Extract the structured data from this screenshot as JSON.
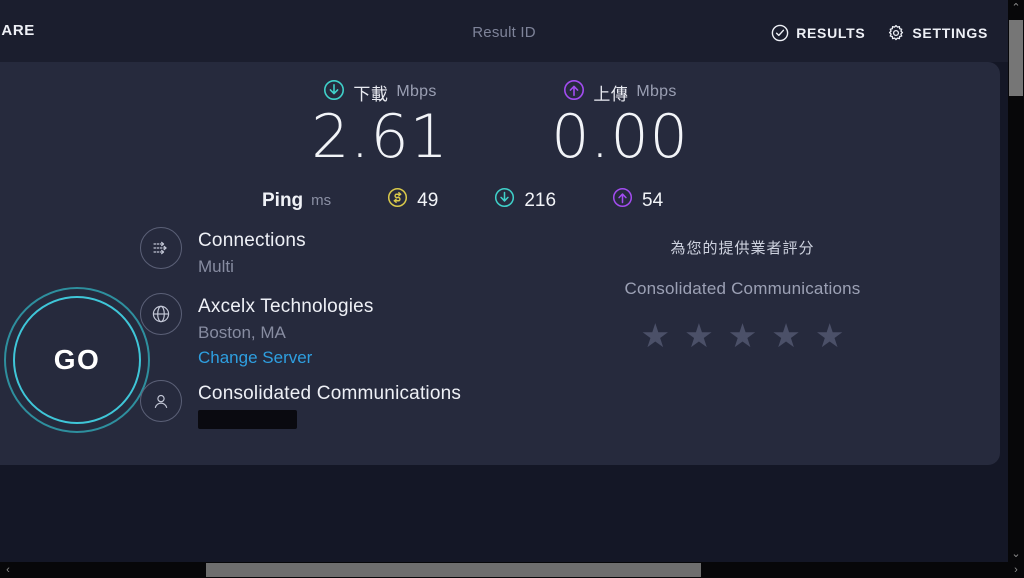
{
  "header": {
    "share_label": "HARE",
    "result_id_label": "Result ID",
    "results_label": "RESULTS",
    "settings_label": "SETTINGS",
    "results_icon": "check-circle-icon",
    "settings_icon": "gear-icon"
  },
  "speeds": {
    "download": {
      "label_cjk": "下載",
      "unit": "Mbps",
      "value": "2.61",
      "icon": "download-arrow-icon",
      "color": "#3fd0c9"
    },
    "upload": {
      "label_cjk": "上傳",
      "unit": "Mbps",
      "value": "0.00",
      "icon": "upload-arrow-icon",
      "color": "#a24cf0"
    }
  },
  "ping": {
    "title": "Ping",
    "unit": "ms",
    "idle": {
      "value": "49",
      "icon": "idle-latency-icon",
      "color": "#d8c84a"
    },
    "download": {
      "value": "216",
      "icon": "download-arrow-icon",
      "color": "#3fd0c9"
    },
    "upload": {
      "value": "54",
      "icon": "upload-arrow-icon",
      "color": "#a24cf0"
    }
  },
  "go_button": {
    "label": "GO",
    "ring_color": "#3fc6d8"
  },
  "info": {
    "connections": {
      "icon": "multi-connection-icon",
      "primary": "Connections",
      "secondary": "Multi"
    },
    "server": {
      "icon": "globe-icon",
      "primary": "Axcelx Technologies",
      "secondary": "Boston, MA",
      "link": "Change Server",
      "link_color": "#2e9fe0"
    },
    "isp": {
      "icon": "person-icon",
      "primary": "Consolidated Communications",
      "ip_redacted": ""
    }
  },
  "rating": {
    "title": "為您的提供業者評分",
    "isp": "Consolidated Communications",
    "stars": [
      "★",
      "★",
      "★",
      "★",
      "★"
    ],
    "filled_count": "0",
    "star_color": "#4b5068"
  },
  "scrollbars": {
    "vertical_up": "⌃",
    "vertical_down": "⌄",
    "horizontal_left": "‹",
    "horizontal_right": "›"
  }
}
